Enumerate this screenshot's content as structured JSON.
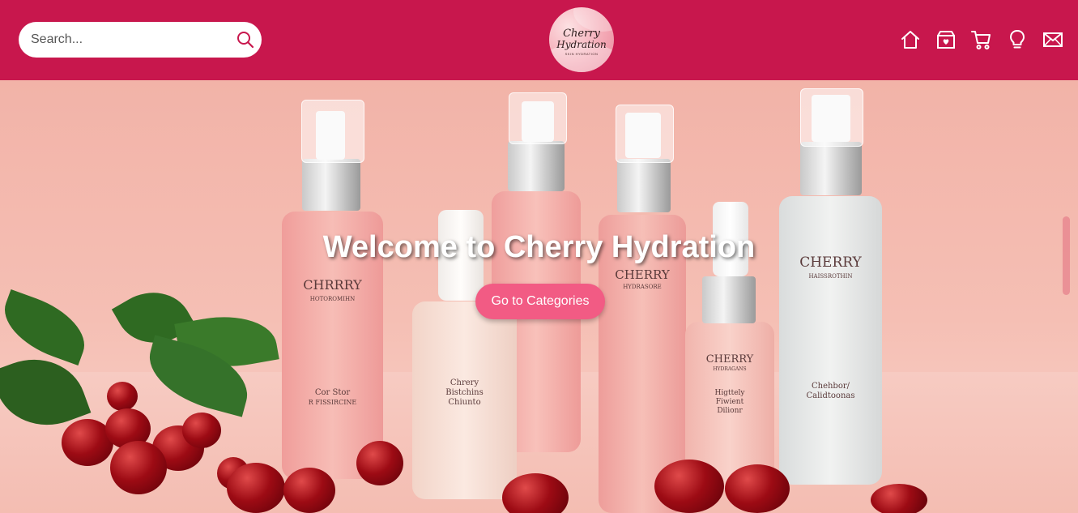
{
  "header": {
    "search": {
      "placeholder": "Search...",
      "icon": "search-icon"
    },
    "logo": {
      "line1": "Cherry",
      "line2": "Hydration",
      "line3": "SKIN HYDRATION"
    },
    "nav": [
      {
        "name": "home-icon"
      },
      {
        "name": "favorites-box-icon"
      },
      {
        "name": "cart-icon"
      },
      {
        "name": "lightbulb-icon"
      },
      {
        "name": "mail-icon"
      }
    ]
  },
  "hero": {
    "title": "Welcome to Cherry Hydration",
    "cta_label": "Go to Categories",
    "bottle_labels": {
      "b1_brand": "CHRRRY",
      "b1_sub": "HOTOROMIHN",
      "b1_text": "Cor Stor",
      "b1_text2": "R FISSIRCINE",
      "b2_text": "Chrery",
      "b2_text2": "Bistchins",
      "b2_text3": "Chiunto",
      "b3_brand": "CHERRY",
      "b3_sub": "HYDRASORE",
      "b4_brand": "CHERRY",
      "b4_sub": "HYDRASORE",
      "b5_brand": "CHERRY",
      "b5_sub": "HYDRAGANS",
      "b5_text": "Higttely",
      "b5_text2": "Fiwient",
      "b5_text3": "Dilionr",
      "b6_brand": "CHERRY",
      "b6_sub": "HAISSROTHIN",
      "b6_text": "Chehbor/",
      "b6_text2": "Calidtoonas"
    }
  },
  "colors": {
    "header": "#c8174d",
    "cta": "#f25b84",
    "hero_bg": "#f2b3a8"
  }
}
